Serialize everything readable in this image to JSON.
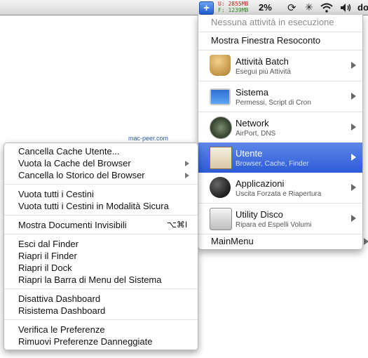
{
  "menubar": {
    "app_icon_glyph": "+",
    "mem_used": "U: 2855MB",
    "mem_free": "F: 1239MB",
    "cpu": "2%",
    "clock_partial": "do"
  },
  "right_menu": {
    "status": "Nessuna attività in esecuzione",
    "report": "Mostra Finestra Resoconto",
    "items": [
      {
        "title": "Attività Batch",
        "subtitle": "Esegui più Attività",
        "icon": "broom-icon"
      },
      {
        "title": "Sistema",
        "subtitle": "Permessi, Script di Cron",
        "icon": "monitor-icon"
      },
      {
        "title": "Network",
        "subtitle": "AirPort, DNS",
        "icon": "radar-icon"
      },
      {
        "title": "Utente",
        "subtitle": "Browser, Cache, Finder",
        "icon": "house-icon"
      },
      {
        "title": "Applicazioni",
        "subtitle": "Uscita Forzata e Riapertura",
        "icon": "bomb-icon"
      },
      {
        "title": "Utility Disco",
        "subtitle": "Ripara ed Espelli Volumi",
        "icon": "disk-icon"
      }
    ],
    "main_menu": "MainMenu"
  },
  "watermark": "mac-peer.com",
  "left_menu": {
    "items": [
      "Cancella Cache Utente...",
      "Vuota la Cache del Browser",
      "Cancella lo Storico del Browser",
      "Vuota tutti i Cestini",
      "Vuota tutti i Cestini in Modalità Sicura",
      "Mostra Documenti Invisibili",
      "Esci dal Finder",
      "Riapri il Finder",
      "Riapri il Dock",
      "Riapri la Barra di Menu del Sistema",
      "Disattiva Dashboard",
      "Risistema Dashboard",
      "Verifica le Preferenze",
      "Rimuovi Preferenze Danneggiate"
    ],
    "shortcut_invisible": "⌥⌘I"
  },
  "colors": {
    "selection": "#2d5bd7",
    "mem_used": "#c61a1a",
    "mem_free": "#2d8a1f"
  }
}
